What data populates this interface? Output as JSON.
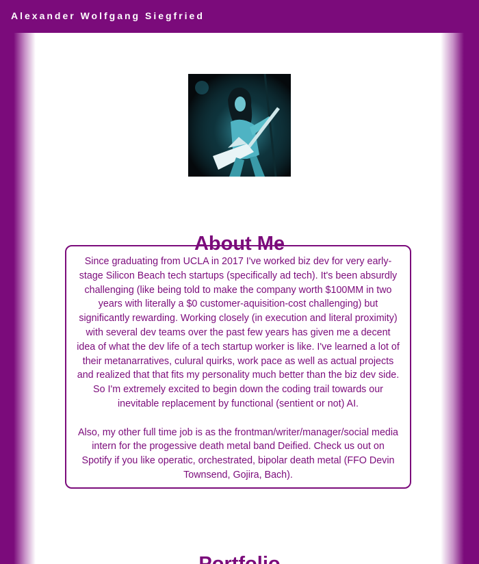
{
  "header": {
    "site_title": "Alexander Wolfgang Siegfried"
  },
  "colors": {
    "brand": "#7b0b7b",
    "background": "#ffffff"
  },
  "profile": {
    "photo_alt": "Guitarist performing on stage with a flying-V guitar"
  },
  "about": {
    "title": "About Me",
    "paragraphs": [
      "Since graduating from UCLA in 2017 I've worked biz dev for very early-stage Silicon Beach tech startups (specifically ad tech). It's been absurdly challenging (like being told to make the company worth $100MM in two years with literally a $0 customer-aquisition-cost challenging) but significantly rewarding. Working closely (in execution and literal proximity) with several dev teams over the past few years has given me a decent idea of what the dev life of a tech startup worker is like. I've learned a lot of their metanarratives, culural quirks, work pace as well as actual projects and realized that that fits my personality much better than the biz dev side. So I'm extremely excited to begin down the coding trail towards our inevitable replacement by functional (sentient or not) AI.",
      "Also, my other full time job is as the frontman/writer/manager/social media intern for the progessive death metal band Deified. Check us out on Spotify if you like operatic, orchestrated, bipolar death metal (FFO Devin Townsend, Gojira, Bach)."
    ]
  },
  "portfolio": {
    "title": "Portfolio"
  }
}
